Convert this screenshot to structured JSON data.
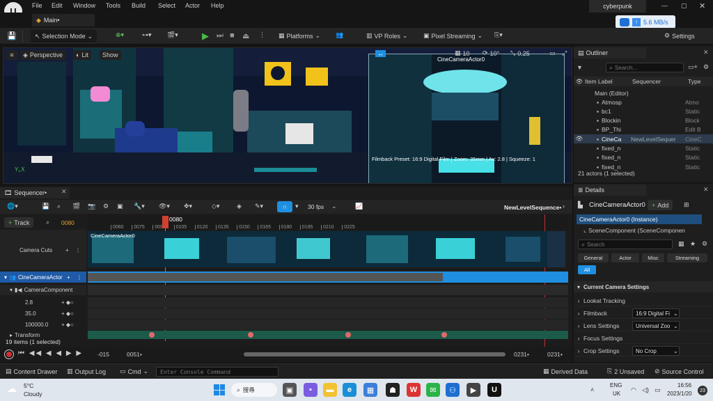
{
  "menu": {
    "file": "File",
    "edit": "Edit",
    "window": "Window",
    "tools": "Tools",
    "build": "Build",
    "select": "Select",
    "actor": "Actor",
    "help": "Help"
  },
  "title_bar": {
    "project": "cyberpunk",
    "net_speed": "5.6 MB/s"
  },
  "tabs": {
    "main": "Main•"
  },
  "toolbar": {
    "selection_mode": "Selection Mode",
    "platforms": "Platforms",
    "vp_roles": "VP Roles",
    "pixel_streaming": "Pixel Streaming",
    "settings": "Settings"
  },
  "viewport": {
    "perspective": "Perspective",
    "lit": "Lit",
    "show": "Show",
    "camera_actor": "CineCameraActor0",
    "filmback_info": "Filmback Preset: 16:9 Digital Film | Zoom: 35mm | Av: 2.8 | Squeeze: 1",
    "grid_snap": "10",
    "rot_snap": "10°",
    "scale_snap": "0.25"
  },
  "outliner": {
    "title": "Outliner",
    "search_placeholder": "Search...",
    "col_item": "Item Label",
    "col_seq": "Sequencer",
    "col_type": "Type",
    "root": "Main (Editor)",
    "items": [
      {
        "label": "Atmosp",
        "seq": "",
        "type": "Atmo"
      },
      {
        "label": "bc1",
        "seq": "",
        "type": "Static"
      },
      {
        "label": "Blockin",
        "seq": "",
        "type": "Block"
      },
      {
        "label": "BP_Thi",
        "seq": "",
        "type": "Edit B"
      },
      {
        "label": "CineCa",
        "seq": "NewLevelSequer",
        "type": "CineC"
      },
      {
        "label": "fixed_n",
        "seq": "",
        "type": "Static"
      },
      {
        "label": "fixed_n",
        "seq": "",
        "type": "Static"
      },
      {
        "label": "fixed_n",
        "seq": "",
        "type": "Static"
      }
    ],
    "footer": "21 actors (1 selected)"
  },
  "details": {
    "title": "Details",
    "actor": "CineCameraActor0",
    "add": "Add",
    "instance": "CineCameraActor0 (Instance)",
    "component": "SceneComponent (SceneComponen",
    "search_placeholder": "Search",
    "filters": [
      "General",
      "Actor",
      "Misc",
      "Streaming",
      "All"
    ],
    "section": "Current Camera Settings",
    "props": [
      {
        "label": "Lookat Tracking",
        "value": ""
      },
      {
        "label": "Filmback",
        "value": "16:9 Digital Fi"
      },
      {
        "label": "Lens Settings",
        "value": "Universal Zoo"
      },
      {
        "label": "Focus Settings",
        "value": ""
      },
      {
        "label": "Crop Settings",
        "value": "No Crop"
      }
    ]
  },
  "sequencer": {
    "tab": "Sequencer•",
    "track_btn": "Track",
    "frame": "0080",
    "fps": "30 fps",
    "sequence_name": "NewLevelSequence•",
    "playhead": "0080",
    "ticks": [
      "0060",
      "0075",
      "0090",
      "0105",
      "0120",
      "0135",
      "0150",
      "0165",
      "0180",
      "0195",
      "0210",
      "0225"
    ],
    "tracks": {
      "camera_cuts": "Camera Cuts",
      "camera_actor": "CineCameraActor",
      "camera_component": "CameraComponent",
      "v1": "2.8",
      "v2": "35.0",
      "v3": "100000.0",
      "transform": "Transform"
    },
    "shot_label": "CineCameraActor0",
    "footer_count": "19 items (1 selected)",
    "range_start": "-015",
    "range_in": "0051•",
    "range_out": "0231•",
    "range_end": "0231•"
  },
  "statusbar": {
    "content_drawer": "Content Drawer",
    "output_log": "Output Log",
    "cmd": "Cmd",
    "console_placeholder": "Enter Console Command",
    "derived_data": "Derived Data",
    "unsaved": "2 Unsaved",
    "source_control": "Source Control"
  },
  "taskbar": {
    "temp": "5°C",
    "weather": "Cloudy",
    "search": "搜尋",
    "lang1": "ENG",
    "lang2": "UK",
    "time": "16:56",
    "date": "2023/1/20",
    "badge": "23"
  },
  "colors": {
    "accent": "#1f8fe0",
    "play_green": "#47b847",
    "red_marker": "#d04030"
  }
}
